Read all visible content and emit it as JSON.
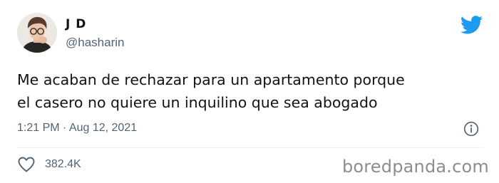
{
  "tweet": {
    "display_name": "J D",
    "handle": "@hasharin",
    "text_lines": [
      "Me acaban de rechazar para un apartamento porque",
      "el casero no quiere un inquilino que sea abogado"
    ],
    "timestamp": "1:21 PM · Aug 12, 2021",
    "likes": "382.4K"
  },
  "icons": {
    "brand": "twitter-bird-icon",
    "info": "info-icon",
    "like": "heart-icon"
  },
  "colors": {
    "twitter_blue": "#1d9bf0",
    "text_primary": "#0f1419",
    "text_secondary": "#536471",
    "watermark": "#8d8d8d"
  },
  "watermark": {
    "text": "boredpanda.com"
  }
}
